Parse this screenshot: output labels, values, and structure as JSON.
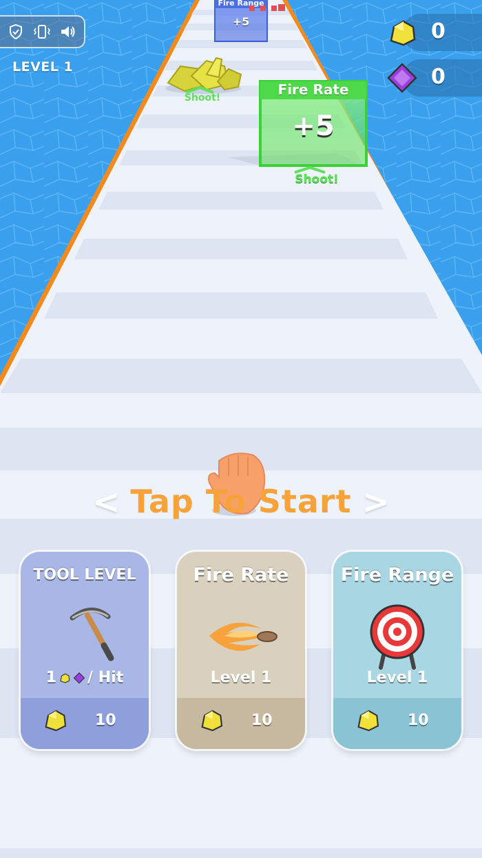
{
  "hud": {
    "level_label": "LEVEL 1",
    "gold_count": "0",
    "gem_count": "0",
    "icons": [
      "privacy-shield-icon",
      "vibration-icon",
      "sound-icon"
    ]
  },
  "track": {
    "gate_far_title": "Fire Range",
    "gate_far_value": "+5",
    "gate_near_title": "Fire Rate",
    "gate_near_value": "+5",
    "shoot_label": "Shoot!"
  },
  "start_prompt": {
    "text": "Tap To Start",
    "left_arrow": "<",
    "right_arrow": ">"
  },
  "upgrades": [
    {
      "title": "TOOL LEVEL",
      "stat_prefix": "1",
      "stat_suffix": "/ Hit",
      "cost": "10",
      "icon": "pickaxe-icon",
      "color": "#a9b7e6"
    },
    {
      "title": "Fire Rate",
      "stat": "Level 1",
      "cost": "10",
      "icon": "fire-bullet-icon",
      "color": "#d9d0bd"
    },
    {
      "title": "Fire Range",
      "stat": "Level 1",
      "cost": "10",
      "icon": "target-icon",
      "color": "#a8d6e2"
    }
  ],
  "colors": {
    "water": "#3aa0ee",
    "track_edge": "#f58a1c",
    "gold": "#f0e13a",
    "gem": "#9a3fe0",
    "start_text": "#f7a23a",
    "gate_green": "#5ee05a"
  }
}
